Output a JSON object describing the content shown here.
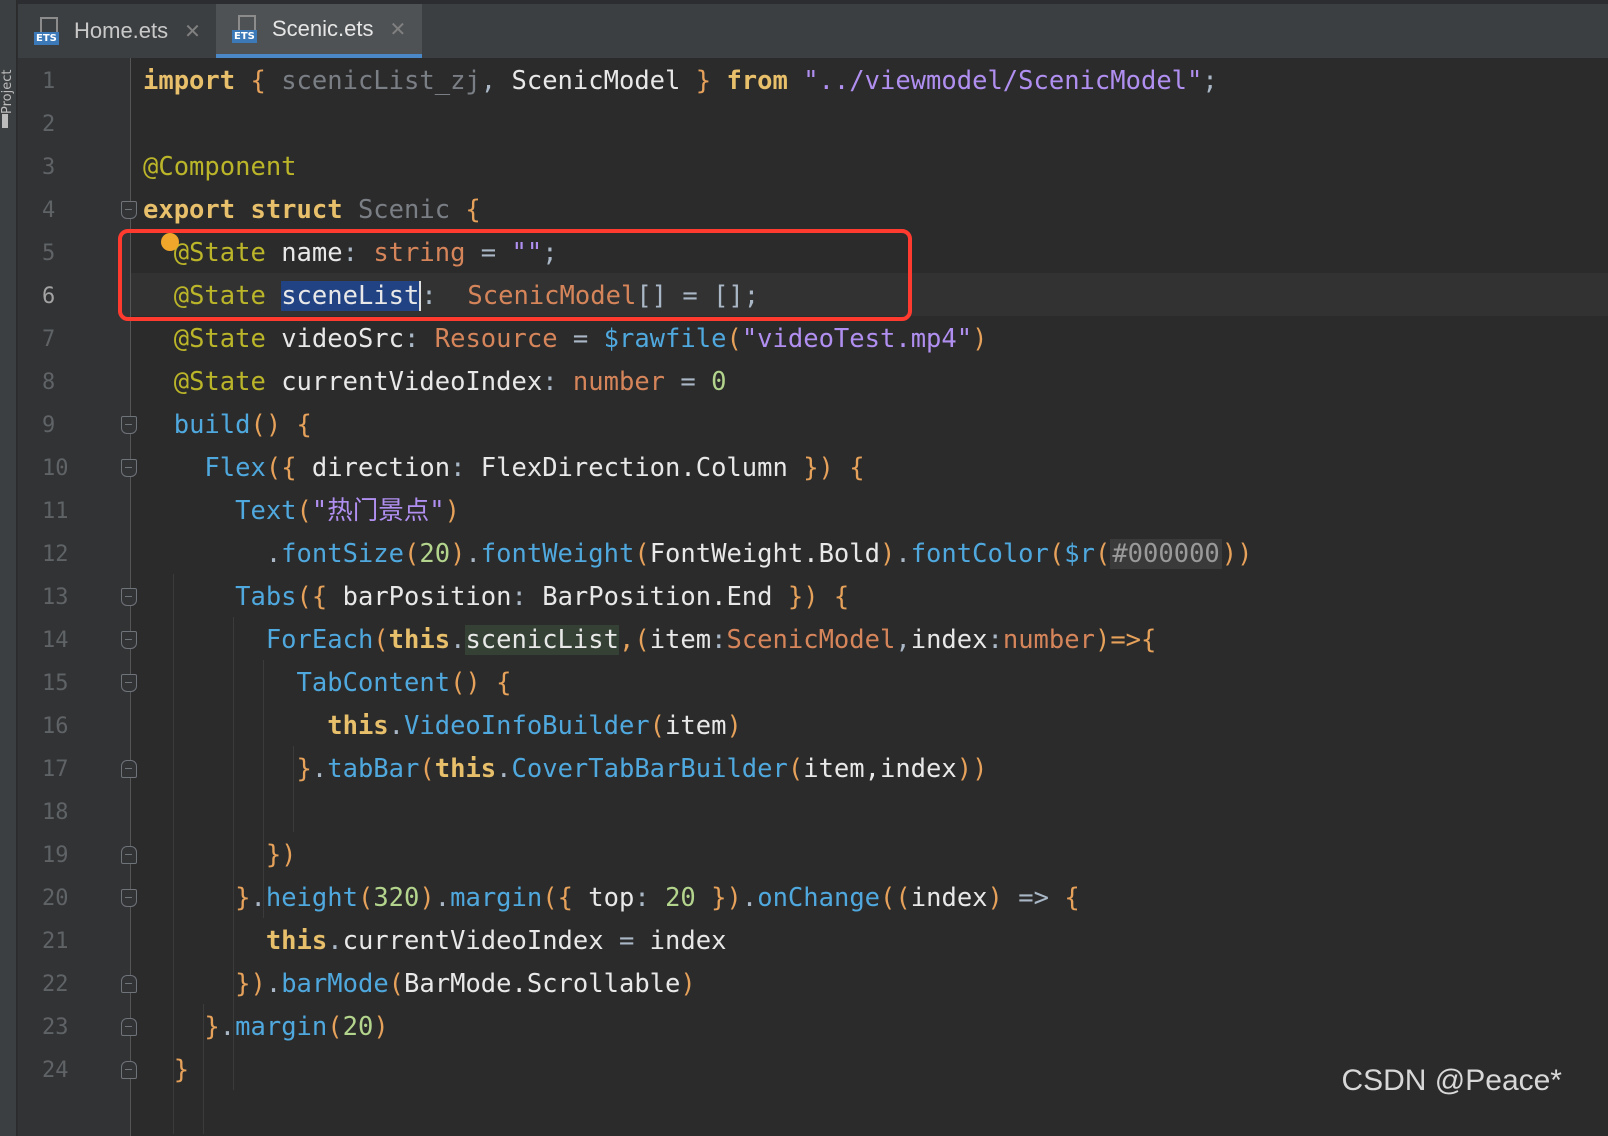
{
  "sidebar": {
    "project_label": "Project"
  },
  "tabs": [
    {
      "label": "Home.ets",
      "icon": "ets-file-icon",
      "active": false
    },
    {
      "label": "Scenic.ets",
      "icon": "ets-file-icon",
      "active": true
    }
  ],
  "icon_badge": "ETS",
  "close_glyph": "✕",
  "editor": {
    "current_line": 6,
    "line_numbers": [
      "1",
      "2",
      "3",
      "4",
      "5",
      "6",
      "7",
      "8",
      "9",
      "10",
      "11",
      "12",
      "13",
      "14",
      "15",
      "16",
      "17",
      "18",
      "19",
      "20",
      "21",
      "22",
      "23",
      "24"
    ],
    "lines": [
      [
        [
          "kw2",
          "import"
        ],
        [
          "br",
          " { "
        ],
        [
          "dim",
          "scenicList_zj"
        ],
        [
          "",
          ", "
        ],
        [
          "cls",
          "ScenicModel"
        ],
        [
          "br",
          " } "
        ],
        [
          "kw2",
          "from "
        ],
        [
          "str",
          "\"../viewmodel/ScenicModel\""
        ],
        [
          "",
          ";"
        ]
      ],
      [],
      [
        [
          "ann",
          "@Component"
        ]
      ],
      [
        [
          "kw2",
          "export struct "
        ],
        [
          "dim",
          "Scenic "
        ],
        [
          "br",
          "{"
        ]
      ],
      [
        [
          "",
          "  "
        ],
        [
          "ann",
          "@State "
        ],
        [
          "cls",
          "name"
        ],
        [
          "",
          ": "
        ],
        [
          "pty",
          "string"
        ],
        [
          "",
          " = "
        ],
        [
          "str",
          "\"\""
        ],
        [
          "",
          ";"
        ]
      ],
      [
        [
          "",
          "  "
        ],
        [
          "ann",
          "@State "
        ],
        [
          "cls hl",
          "sceneList"
        ],
        [
          "caret",
          ""
        ],
        [
          "",
          ":  "
        ],
        [
          "pty",
          "ScenicModel"
        ],
        [
          "",
          "[] = [];"
        ]
      ],
      [
        [
          "",
          "  "
        ],
        [
          "ann",
          "@State "
        ],
        [
          "cls",
          "videoSrc"
        ],
        [
          "",
          ": "
        ],
        [
          "pty",
          "Resource"
        ],
        [
          "",
          " = "
        ],
        [
          "fn",
          "$rawfile"
        ],
        [
          "br",
          "("
        ],
        [
          "str",
          "\"videoTest.mp4\""
        ],
        [
          "br",
          ")"
        ]
      ],
      [
        [
          "",
          "  "
        ],
        [
          "ann",
          "@State "
        ],
        [
          "cls",
          "currentVideoIndex"
        ],
        [
          "",
          ": "
        ],
        [
          "pty",
          "number"
        ],
        [
          "",
          " = "
        ],
        [
          "num",
          "0"
        ]
      ],
      [
        [
          "",
          "  "
        ],
        [
          "fn",
          "build"
        ],
        [
          "br",
          "() {"
        ]
      ],
      [
        [
          "",
          "    "
        ],
        [
          "fn",
          "Flex"
        ],
        [
          "br",
          "({ "
        ],
        [
          "cls",
          "direction"
        ],
        [
          "",
          ": "
        ],
        [
          "cls",
          "FlexDirection.Column"
        ],
        [
          "br",
          " }) {"
        ]
      ],
      [
        [
          "",
          "      "
        ],
        [
          "fn",
          "Text"
        ],
        [
          "br",
          "("
        ],
        [
          "str",
          "\"热门景点\""
        ],
        [
          "br",
          ")"
        ]
      ],
      [
        [
          "",
          "        ."
        ],
        [
          "fn",
          "fontSize"
        ],
        [
          "br",
          "("
        ],
        [
          "num",
          "20"
        ],
        [
          "br",
          ")"
        ],
        [
          "",
          "."
        ],
        [
          "fn",
          "fontWeight"
        ],
        [
          "br",
          "("
        ],
        [
          "cls",
          "FontWeight.Bold"
        ],
        [
          "br",
          ")"
        ],
        [
          "",
          "."
        ],
        [
          "fn",
          "fontColor"
        ],
        [
          "br",
          "("
        ],
        [
          "fn",
          "$r"
        ],
        [
          "br",
          "("
        ],
        [
          "colorchip",
          "#000000"
        ],
        [
          "br",
          "))"
        ]
      ],
      [
        [
          "",
          "      "
        ],
        [
          "fn",
          "Tabs"
        ],
        [
          "br",
          "({ "
        ],
        [
          "cls",
          "barPosition"
        ],
        [
          "",
          ": "
        ],
        [
          "cls",
          "BarPosition.End"
        ],
        [
          "br",
          " }) {"
        ]
      ],
      [
        [
          "",
          "        "
        ],
        [
          "fn",
          "ForEach"
        ],
        [
          "br",
          "("
        ],
        [
          "kw2",
          "this"
        ],
        [
          "",
          "."
        ],
        [
          "cls hl2",
          "scenicList"
        ],
        [
          "br",
          ",("
        ],
        [
          "cls",
          "item"
        ],
        [
          "",
          ":"
        ],
        [
          "pty",
          "ScenicModel"
        ],
        [
          "",
          ","
        ],
        [
          "cls",
          "index"
        ],
        [
          "",
          ":"
        ],
        [
          "pty",
          "number"
        ],
        [
          "br",
          ")=>{"
        ]
      ],
      [
        [
          "",
          "          "
        ],
        [
          "fn",
          "TabContent"
        ],
        [
          "br",
          "() {"
        ]
      ],
      [
        [
          "",
          "            "
        ],
        [
          "kw2",
          "this"
        ],
        [
          "",
          "."
        ],
        [
          "fn",
          "VideoInfoBuilder"
        ],
        [
          "br",
          "("
        ],
        [
          "cls",
          "item"
        ],
        [
          "br",
          ")"
        ]
      ],
      [
        [
          "",
          "          "
        ],
        [
          "br",
          "}"
        ],
        [
          "",
          "."
        ],
        [
          "fn",
          "tabBar"
        ],
        [
          "br",
          "("
        ],
        [
          "kw2",
          "this"
        ],
        [
          "",
          "."
        ],
        [
          "fn",
          "CoverTabBarBuilder"
        ],
        [
          "br",
          "("
        ],
        [
          "cls",
          "item,index"
        ],
        [
          "br",
          "))"
        ]
      ],
      [],
      [
        [
          "",
          "        "
        ],
        [
          "br",
          "})"
        ]
      ],
      [
        [
          "",
          "      "
        ],
        [
          "br",
          "}"
        ],
        [
          "",
          "."
        ],
        [
          "fn",
          "height"
        ],
        [
          "br",
          "("
        ],
        [
          "num",
          "320"
        ],
        [
          "br",
          ")"
        ],
        [
          "",
          "."
        ],
        [
          "fn",
          "margin"
        ],
        [
          "br",
          "({ "
        ],
        [
          "cls",
          "top"
        ],
        [
          "",
          ": "
        ],
        [
          "num",
          "20"
        ],
        [
          "br",
          " })"
        ],
        [
          "",
          "."
        ],
        [
          "fn",
          "onChange"
        ],
        [
          "br",
          "(("
        ],
        [
          "cls",
          "index"
        ],
        [
          "br",
          ")"
        ],
        [
          "",
          " => "
        ],
        [
          "br",
          "{"
        ]
      ],
      [
        [
          "",
          "        "
        ],
        [
          "kw2",
          "this"
        ],
        [
          "",
          "."
        ],
        [
          "cls",
          "currentVideoIndex"
        ],
        [
          "",
          " = "
        ],
        [
          "cls",
          "index"
        ]
      ],
      [
        [
          "",
          "      "
        ],
        [
          "br",
          "})"
        ],
        [
          "",
          "."
        ],
        [
          "fn",
          "barMode"
        ],
        [
          "br",
          "("
        ],
        [
          "cls",
          "BarMode.Scrollable"
        ],
        [
          "br",
          ")"
        ]
      ],
      [
        [
          "",
          "    "
        ],
        [
          "br",
          "}"
        ],
        [
          "",
          "."
        ],
        [
          "fn",
          "margin"
        ],
        [
          "br",
          "("
        ],
        [
          "num",
          "20"
        ],
        [
          "br",
          ")"
        ]
      ],
      [
        [
          "",
          "  "
        ],
        [
          "br",
          "}"
        ]
      ]
    ]
  },
  "watermark": "CSDN @Peace*"
}
